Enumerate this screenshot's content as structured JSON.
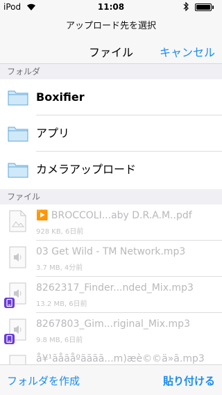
{
  "status_bar": {
    "carrier": "iPod",
    "time": "11:08"
  },
  "header": {
    "prompt": "アップロード先を選択",
    "title": "ファイル",
    "cancel_label": "キャンセル"
  },
  "sections": {
    "folders": "フォルダ",
    "files": "ファイル"
  },
  "folders": [
    {
      "label": "Boxifier",
      "bold": true
    },
    {
      "label": "アプリ",
      "bold": false
    },
    {
      "label": "カメラアップロード",
      "bold": false
    }
  ],
  "files": [
    {
      "name": "▶️ BROCCOLI...aby D.R.A.M..pdf",
      "meta": "928 KB, 6日前",
      "icon": "pdf-file-icon",
      "badge": false
    },
    {
      "name": "03 Get Wild - TM Network.mp3",
      "meta": "3.7 MB, 4分前",
      "icon": "audio-file-icon",
      "badge": false
    },
    {
      "name": "8262317_Finder...nded_Mix.mp3",
      "meta": "13.2 MB, 6日前",
      "icon": "audio-file-icon",
      "badge": true
    },
    {
      "name": "8267803_Gim...riginal_Mix.mp3",
      "meta": "9.8 MB, 6日前",
      "icon": "audio-file-icon",
      "badge": true
    },
    {
      "name": "å¥¹ãåãåºãããã...m)æè©©ä»ã.mp3",
      "meta": "",
      "icon": "audio-file-icon",
      "badge": false
    }
  ],
  "toolbar": {
    "create_folder_label": "フォルダを作成",
    "paste_label": "貼り付ける"
  },
  "colors": {
    "accent": "#1a8cf0",
    "folder_fill": "#cfe9f9",
    "folder_stroke": "#5fa8d8",
    "badge": "#6a3bd8"
  }
}
